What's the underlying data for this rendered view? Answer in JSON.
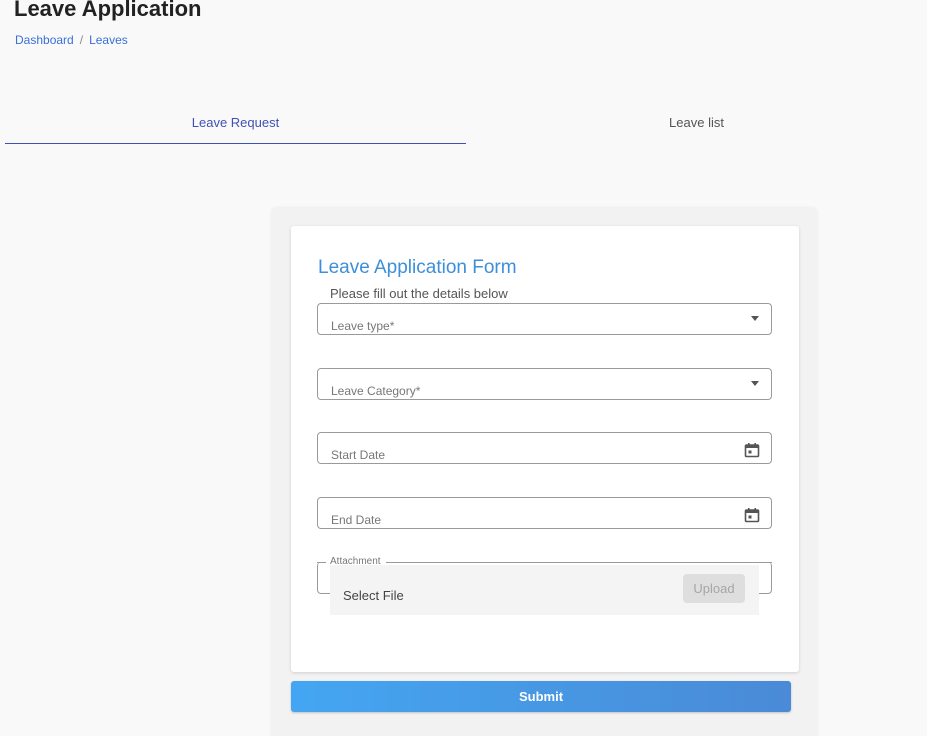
{
  "header": {
    "title": "Leave Application",
    "breadcrumb": {
      "items": [
        "Dashboard",
        "Leaves"
      ],
      "separator": "/"
    }
  },
  "tabs": [
    {
      "label": "Leave Request",
      "active": true
    },
    {
      "label": "Leave list",
      "active": false
    }
  ],
  "form": {
    "title": "Leave Application Form",
    "subtitle": "Please fill out the details below",
    "fields": {
      "leave_type": {
        "label": "Leave type*",
        "icon": "dropdown-caret-icon"
      },
      "leave_category": {
        "label": "Leave Category*",
        "icon": "dropdown-caret-icon"
      },
      "start_date": {
        "label": "Start Date",
        "icon": "calendar-icon"
      },
      "end_date": {
        "label": "End Date",
        "icon": "calendar-icon"
      }
    },
    "attachment": {
      "legend": "Attachment",
      "select_label": "Select File",
      "upload_label": "Upload"
    },
    "submit_label": "Submit"
  },
  "colors": {
    "accent": "#3f51b5",
    "title_blue": "#3d8fd8",
    "submit_gradient_start": "#44a6f2",
    "submit_gradient_end": "#4a8ad6"
  }
}
